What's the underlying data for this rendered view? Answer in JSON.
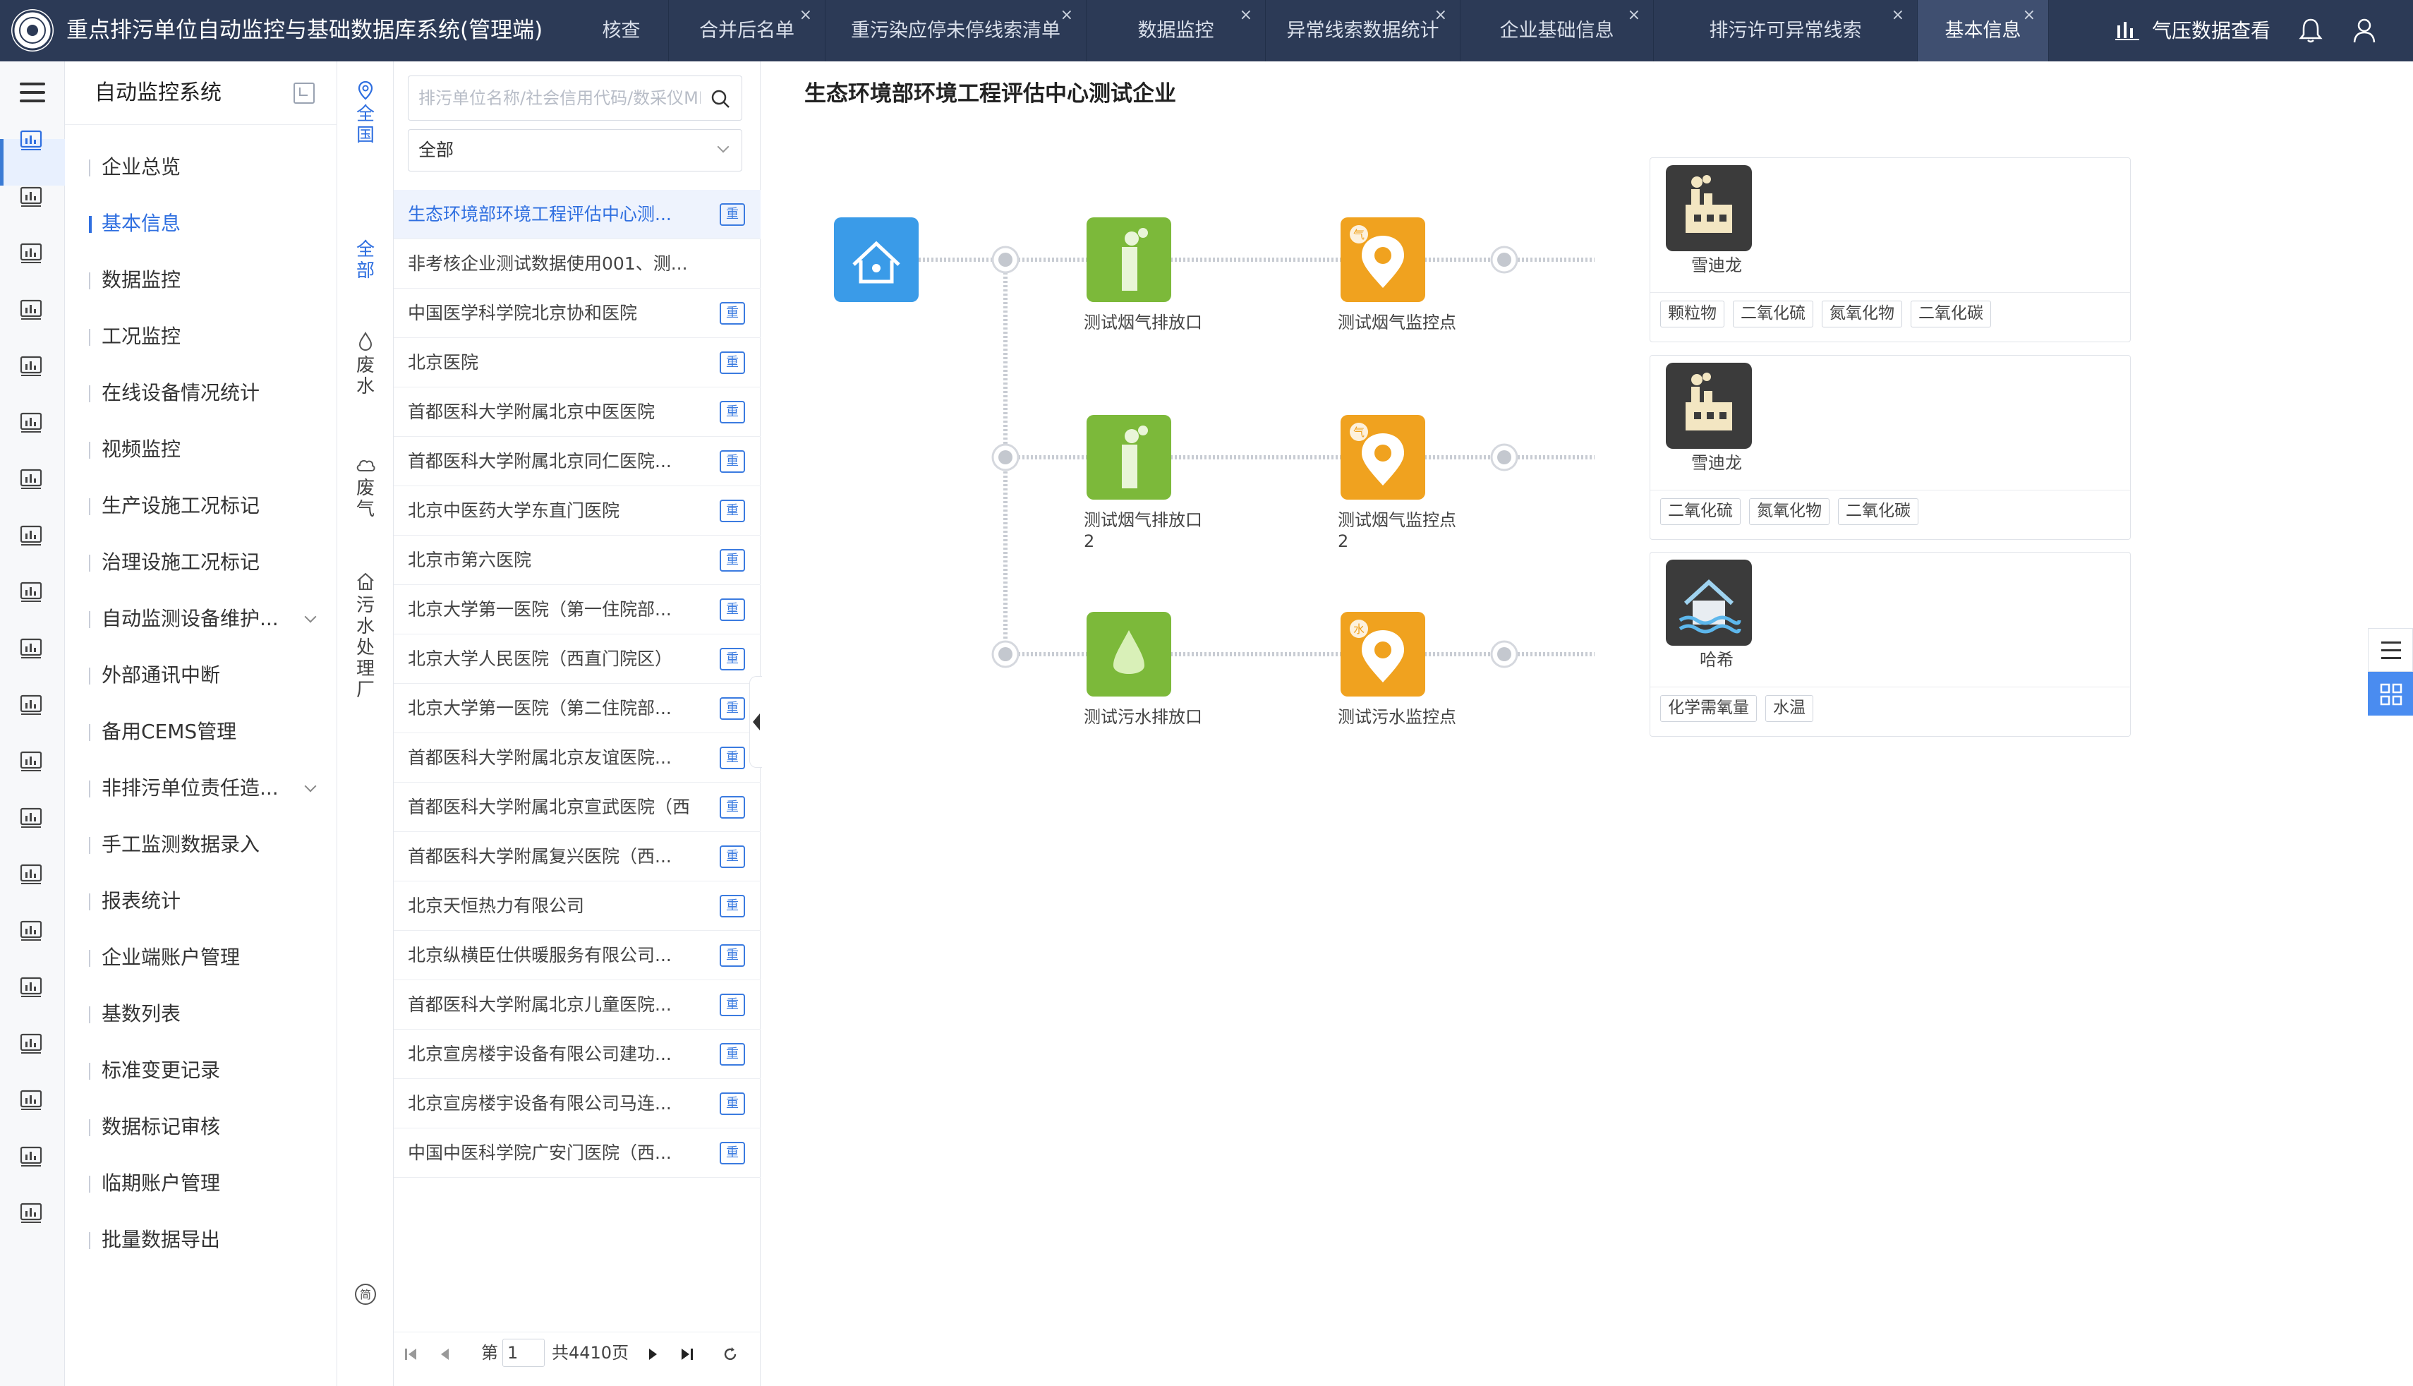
{
  "app": {
    "title": "重点排污单位自动监控与基础数据库系统(管理端)",
    "logo_icon": "emblem-logo"
  },
  "tabs": [
    {
      "label": "核查",
      "closable": false,
      "active": false
    },
    {
      "label": "合并后名单",
      "closable": true,
      "active": false
    },
    {
      "label": "重污染应停未停线索清单",
      "closable": true,
      "active": false
    },
    {
      "label": "数据监控",
      "closable": true,
      "active": false
    },
    {
      "label": "异常线索数据统计",
      "closable": true,
      "active": false
    },
    {
      "label": "企业基础信息",
      "closable": true,
      "active": false
    },
    {
      "label": "排污许可异常线索",
      "closable": true,
      "active": false
    },
    {
      "label": "基本信息",
      "closable": true,
      "active": true
    }
  ],
  "tab_close_symbol": "×",
  "topbar": {
    "pressure_label": "气压数据查看",
    "pressure_icon": "bar-chart-icon",
    "bell_icon": "bell-icon",
    "user_icon": "user-icon"
  },
  "menu": {
    "title": "自动监控系统",
    "items": [
      {
        "label": "企业总览",
        "active": false,
        "expandable": false
      },
      {
        "label": "基本信息",
        "active": true,
        "expandable": false
      },
      {
        "label": "数据监控",
        "active": false,
        "expandable": false
      },
      {
        "label": "工况监控",
        "active": false,
        "expandable": false
      },
      {
        "label": "在线设备情况统计",
        "active": false,
        "expandable": false
      },
      {
        "label": "视频监控",
        "active": false,
        "expandable": false
      },
      {
        "label": "生产设施工况标记",
        "active": false,
        "expandable": false
      },
      {
        "label": "治理设施工况标记",
        "active": false,
        "expandable": false
      },
      {
        "label": "自动监测设备维护...",
        "active": false,
        "expandable": true
      },
      {
        "label": "外部通讯中断",
        "active": false,
        "expandable": false
      },
      {
        "label": "备用CEMS管理",
        "active": false,
        "expandable": false
      },
      {
        "label": "非排污单位责任造...",
        "active": false,
        "expandable": true
      },
      {
        "label": "手工监测数据录入",
        "active": false,
        "expandable": false
      },
      {
        "label": "报表统计",
        "active": false,
        "expandable": false
      },
      {
        "label": "企业端账户管理",
        "active": false,
        "expandable": false
      },
      {
        "label": "基数列表",
        "active": false,
        "expandable": false
      },
      {
        "label": "标准变更记录",
        "active": false,
        "expandable": false
      },
      {
        "label": "数据标记审核",
        "active": false,
        "expandable": false
      },
      {
        "label": "临期账户管理",
        "active": false,
        "expandable": false
      },
      {
        "label": "批量数据导出",
        "active": false,
        "expandable": false
      }
    ]
  },
  "categories": {
    "region": "全国",
    "all": "全部",
    "water": "废水",
    "gas": "废气",
    "sewage": "污水处理厂",
    "bottom_icon": "simplified-icon",
    "bottom_label": "简"
  },
  "list": {
    "search_placeholder": "排污单位名称/社会信用代码/数采仪MN",
    "filter_value": "全部",
    "badge_label": "重",
    "rows": [
      {
        "name": "生态环境部环境工程评估中心测...",
        "badge": true,
        "selected": true
      },
      {
        "name": "非考核企业测试数据使用001、测...",
        "badge": false,
        "selected": false
      },
      {
        "name": "中国医学科学院北京协和医院",
        "badge": true,
        "selected": false
      },
      {
        "name": "北京医院",
        "badge": true,
        "selected": false
      },
      {
        "name": "首都医科大学附属北京中医医院",
        "badge": true,
        "selected": false
      },
      {
        "name": "首都医科大学附属北京同仁医院...",
        "badge": true,
        "selected": false
      },
      {
        "name": "北京中医药大学东直门医院",
        "badge": true,
        "selected": false
      },
      {
        "name": "北京市第六医院",
        "badge": true,
        "selected": false
      },
      {
        "name": "北京大学第一医院（第一住院部...",
        "badge": true,
        "selected": false
      },
      {
        "name": "北京大学人民医院（西直门院区）",
        "badge": true,
        "selected": false
      },
      {
        "name": "北京大学第一医院（第二住院部...",
        "badge": true,
        "selected": false
      },
      {
        "name": "首都医科大学附属北京友谊医院...",
        "badge": true,
        "selected": false
      },
      {
        "name": "首都医科大学附属北京宣武医院（西...",
        "badge": true,
        "selected": false
      },
      {
        "name": "首都医科大学附属复兴医院（西...",
        "badge": true,
        "selected": false
      },
      {
        "name": "北京天恒热力有限公司",
        "badge": true,
        "selected": false
      },
      {
        "name": "北京纵横臣仕供暖服务有限公司...",
        "badge": true,
        "selected": false
      },
      {
        "name": "首都医科大学附属北京儿童医院...",
        "badge": true,
        "selected": false
      },
      {
        "name": "北京宣房楼宇设备有限公司建功...",
        "badge": true,
        "selected": false
      },
      {
        "name": "北京宣房楼宇设备有限公司马连...",
        "badge": true,
        "selected": false
      },
      {
        "name": "中国中医科学院广安门医院（西...",
        "badge": true,
        "selected": false
      }
    ],
    "pager": {
      "page_prefix": "第",
      "page_value": "1",
      "total_label": "共4410页"
    }
  },
  "main": {
    "title": "生态环境部环境工程评估中心测试企业",
    "rows": [
      {
        "outlet": {
          "label": "测试烟气排放口",
          "kind": "gas"
        },
        "monitor": {
          "label": "测试烟气监控点",
          "kind": "gas",
          "tag": "气"
        },
        "device": {
          "name": "雪迪龙",
          "icon": "factory-icon",
          "pollutants": [
            "颗粒物",
            "二氧化硫",
            "氮氧化物",
            "二氧化碳"
          ]
        }
      },
      {
        "outlet": {
          "label": "测试烟气排放口2",
          "kind": "gas"
        },
        "monitor": {
          "label": "测试烟气监控点2",
          "kind": "gas",
          "tag": "气"
        },
        "device": {
          "name": "雪迪龙",
          "icon": "factory-icon",
          "pollutants": [
            "二氧化硫",
            "氮氧化物",
            "二氧化碳"
          ]
        }
      },
      {
        "outlet": {
          "label": "测试污水排放口",
          "kind": "water"
        },
        "monitor": {
          "label": "测试污水监控点",
          "kind": "water",
          "tag": "水"
        },
        "device": {
          "name": "哈希",
          "icon": "water-plant-icon",
          "pollutants": [
            "化学需氧量",
            "水温"
          ]
        }
      }
    ],
    "colors": {
      "gas_green": "#7cb93a",
      "monitor_orange": "#f0a21f",
      "home_blue": "#3a9be8",
      "device_dark": "#3b3b3b"
    }
  }
}
